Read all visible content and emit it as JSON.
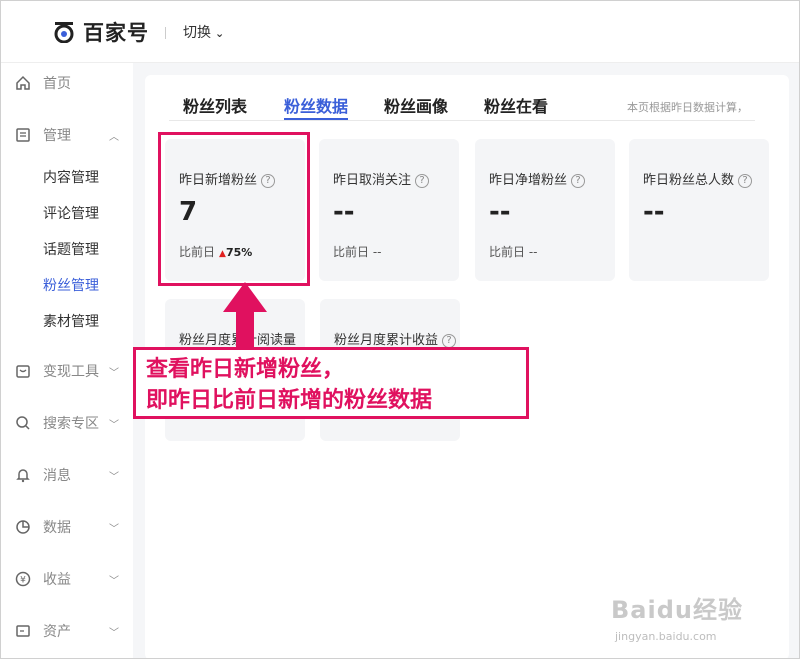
{
  "header": {
    "logo_text": "百家号",
    "switch_label": "切换"
  },
  "sidebar": {
    "items": [
      {
        "label": "首页",
        "icon": "home-icon"
      },
      {
        "label": "管理",
        "icon": "document-icon"
      },
      {
        "label": "变现工具",
        "icon": "wallet-icon"
      },
      {
        "label": "搜索专区",
        "icon": "search-icon"
      },
      {
        "label": "消息",
        "icon": "bell-icon"
      },
      {
        "label": "数据",
        "icon": "pie-chart-icon"
      },
      {
        "label": "收益",
        "icon": "yen-icon"
      },
      {
        "label": "资产",
        "icon": "card-icon"
      }
    ],
    "management_sub": [
      {
        "label": "内容管理"
      },
      {
        "label": "评论管理"
      },
      {
        "label": "话题管理"
      },
      {
        "label": "粉丝管理",
        "active": true
      },
      {
        "label": "素材管理"
      }
    ]
  },
  "main": {
    "tabs": [
      {
        "label": "粉丝列表"
      },
      {
        "label": "粉丝数据",
        "active": true
      },
      {
        "label": "粉丝画像"
      },
      {
        "label": "粉丝在看"
      }
    ],
    "note": "本页根据昨日数据计算，",
    "cards": [
      {
        "title": "昨日新增粉丝",
        "value": "7",
        "compare_label": "比前日",
        "compare_up": "▲",
        "compare_value": "75%"
      },
      {
        "title": "昨日取消关注",
        "value": "--",
        "compare_label": "比前日 --"
      },
      {
        "title": "昨日净增粉丝",
        "value": "--",
        "compare_label": "比前日 --"
      },
      {
        "title": "昨日粉丝总人数",
        "value": "--"
      }
    ],
    "cards_row2": [
      {
        "title": "粉丝月度累计阅读量"
      },
      {
        "title": "粉丝月度累计收益"
      }
    ]
  },
  "annotation": {
    "line1": "查看昨日新增粉丝，",
    "line2": "即昨日比前日新增的粉丝数据",
    "color": "#e0115f"
  },
  "watermark": {
    "main": "Baidu经验",
    "sub": "jingyan.baidu.com"
  },
  "colors": {
    "accent": "#3b5fd9",
    "annotation": "#e0115f",
    "trend_up": "#e02020"
  }
}
